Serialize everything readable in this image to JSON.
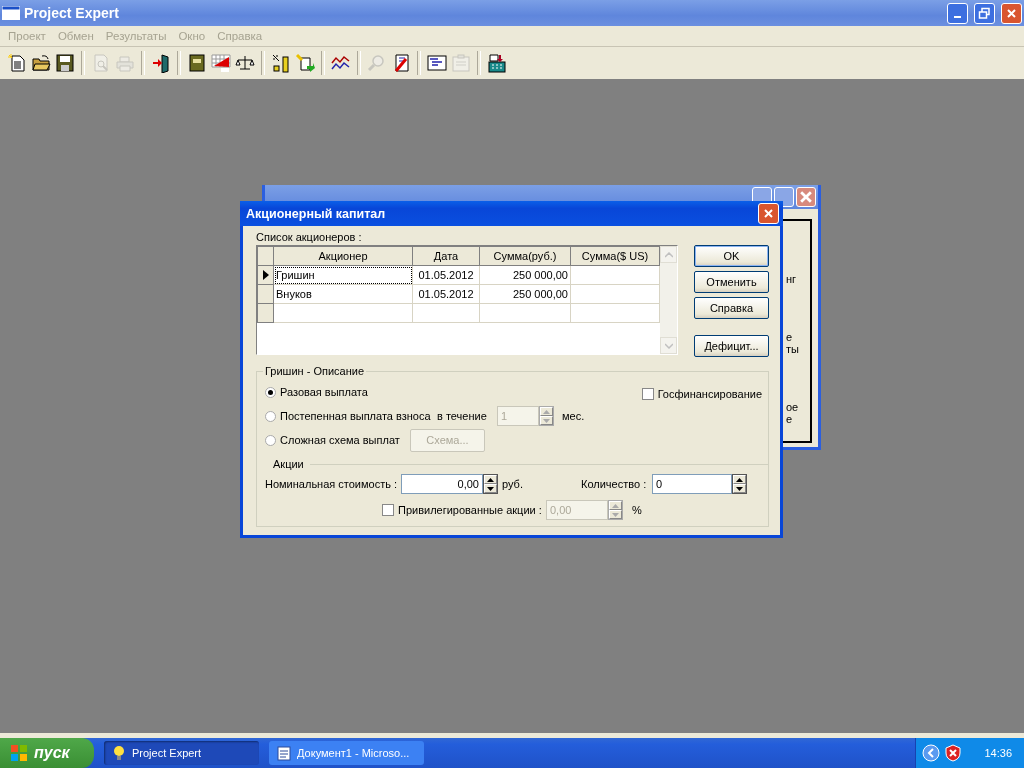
{
  "window": {
    "title": "Project Expert"
  },
  "menu": [
    {
      "label": "Проект",
      "disabled": true
    },
    {
      "label": "Обмен",
      "disabled": true
    },
    {
      "label": "Результаты",
      "disabled": true
    },
    {
      "label": "Окно",
      "disabled": true
    },
    {
      "label": "Справка",
      "disabled": true
    }
  ],
  "toolbar": [
    {
      "kind": "new",
      "disabled": false
    },
    {
      "kind": "open",
      "disabled": false
    },
    {
      "kind": "save",
      "disabled": false
    },
    {
      "kind": "separator"
    },
    {
      "kind": "preview",
      "disabled": true
    },
    {
      "kind": "print",
      "disabled": true
    },
    {
      "kind": "separator"
    },
    {
      "kind": "exit",
      "disabled": false
    },
    {
      "kind": "separator"
    },
    {
      "kind": "book",
      "disabled": false
    },
    {
      "kind": "cashflow",
      "disabled": false
    },
    {
      "kind": "scales",
      "disabled": false
    },
    {
      "kind": "separator"
    },
    {
      "kind": "ruler",
      "disabled": false
    },
    {
      "kind": "export",
      "disabled": false
    },
    {
      "kind": "separator"
    },
    {
      "kind": "linechart",
      "disabled": false
    },
    {
      "kind": "separator"
    },
    {
      "kind": "magnifier",
      "disabled": true
    },
    {
      "kind": "edit",
      "disabled": false
    },
    {
      "kind": "separator"
    },
    {
      "kind": "windows",
      "disabled": false
    },
    {
      "kind": "clipboard",
      "disabled": true
    },
    {
      "kind": "separator"
    },
    {
      "kind": "calculator",
      "disabled": false
    }
  ],
  "background_window": {
    "fragments": [
      "нг",
      "е",
      "ты",
      "ое",
      "е"
    ]
  },
  "dialog": {
    "title": "Акционерный капитал",
    "list_label": "Список акционеров :",
    "table": {
      "columns": [
        "Акционер",
        "Дата",
        "Сумма(руб.)",
        "Сумма($ US)"
      ],
      "rows": [
        {
          "selected": true,
          "cells": [
            "Гришин",
            "01.05.2012",
            "250 000,00",
            ""
          ]
        },
        {
          "selected": false,
          "cells": [
            "Внуков",
            "01.05.2012",
            "250 000,00",
            ""
          ]
        }
      ]
    },
    "buttons": [
      {
        "label": "OK",
        "default": true
      },
      {
        "label": "Отменить",
        "default": false
      },
      {
        "label": "Справка",
        "default": false
      },
      {
        "label": "Дефицит...",
        "default": false
      }
    ],
    "description": {
      "title": "Гришин - Описание",
      "payment_options": [
        {
          "label": "Разовая выплата",
          "selected": true
        },
        {
          "label": "Постепенная выплата взноса",
          "selected": false
        },
        {
          "label": "Сложная схема выплат",
          "selected": false
        }
      ],
      "period": {
        "label": "в течение",
        "value": "1",
        "unit": "мес.",
        "disabled": true
      },
      "scheme_button": {
        "label": "Схема...",
        "disabled": true
      },
      "state_funding": {
        "label": "Госфинансирование",
        "checked": false
      }
    },
    "shares": {
      "title": "Акции",
      "nominal": {
        "label": "Номинальная стоимость :",
        "value": "0,00",
        "unit": "руб."
      },
      "quantity": {
        "label": "Количество :",
        "value": "0"
      },
      "preferred": {
        "label": "Привилегированные акции :",
        "checked": false,
        "value": "0,00",
        "unit": "%",
        "disabled": true
      }
    }
  },
  "taskbar": {
    "start": "пуск",
    "tasks": [
      {
        "label": "Project Expert",
        "selected": true
      },
      {
        "label": "Документ1 - Microso...",
        "selected": false
      }
    ],
    "clock": "14:36"
  }
}
